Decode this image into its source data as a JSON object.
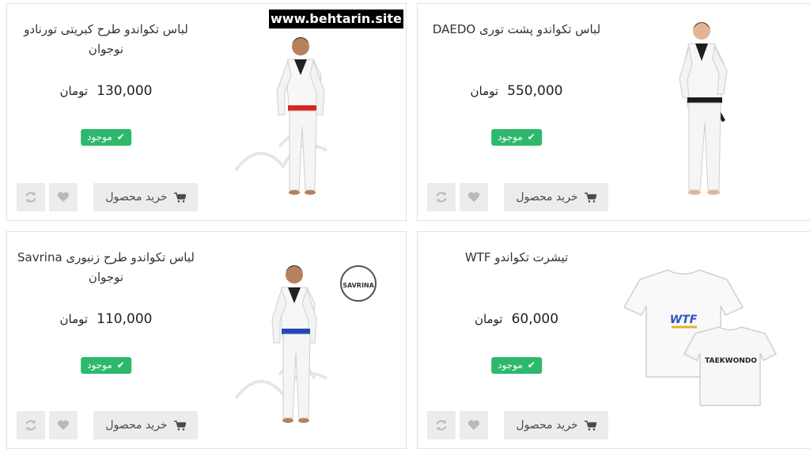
{
  "watermark": "www.behtarin.site",
  "colors": {
    "in_stock": "#2db86c",
    "button_bg": "#ececec"
  },
  "products": [
    {
      "title": "لباس تکواندو طرح کبریتی تورنادو نوجوان",
      "price": "130,000",
      "currency": "تومان",
      "stock": "موجود",
      "buy_label": "خرید محصول",
      "image": "boy-taekwondo-uniform-red-belt"
    },
    {
      "title": "لباس تکواندو پشت توری DAEDO",
      "price": "550,000",
      "currency": "تومان",
      "stock": "موجود",
      "buy_label": "خرید محصول",
      "image": "teen-taekwondo-uniform-black-belt"
    },
    {
      "title": "لباس تکواندو طرح زنبوری Savrina نوجوان",
      "price": "110,000",
      "currency": "تومان",
      "stock": "موجود",
      "buy_label": "خرید محصول",
      "image": "boy-taekwondo-uniform-blue-belt"
    },
    {
      "title": "تیشرت تکواندو WTF",
      "price": "60,000",
      "currency": "تومان",
      "stock": "موجود",
      "buy_label": "خرید محصول",
      "image": "white-wtf-taekwondo-tshirts"
    }
  ]
}
